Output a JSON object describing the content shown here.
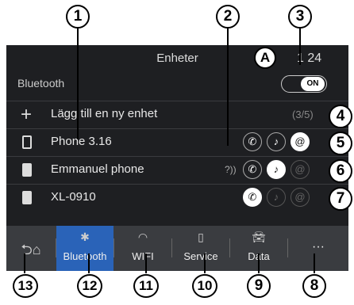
{
  "header": {
    "title": "Enheter",
    "clock": "1 24",
    "marker": "A"
  },
  "bluetooth": {
    "label": "Bluetooth",
    "toggle": "ON"
  },
  "add_device": {
    "label": "Lägg till en ny enhet",
    "count": "(3/5)"
  },
  "devices": [
    {
      "name": "Phone 3.16",
      "icon": "phone-icon"
    },
    {
      "name": "Emmanuel phone",
      "icon": "phone-icon"
    },
    {
      "name": "XL-0910",
      "icon": "phone-icon"
    }
  ],
  "tabs": [
    {
      "label": "",
      "icon": "back-home-icon"
    },
    {
      "label": "Bluetooth",
      "icon": "bluetooth-icon"
    },
    {
      "label": "WIFI",
      "icon": "wifi-icon"
    },
    {
      "label": "Service",
      "icon": "service-icon"
    },
    {
      "label": "Data",
      "icon": "car-data-icon"
    },
    {
      "label": "···",
      "icon": "more-icon"
    }
  ],
  "callouts": [
    "1",
    "2",
    "3",
    "4",
    "5",
    "6",
    "7",
    "8",
    "9",
    "10",
    "11",
    "12",
    "13"
  ],
  "colors": {
    "screen_bg": "#1e1f22",
    "tabbar_bg": "#3a3c40",
    "active_tab": "#2a63b8"
  }
}
